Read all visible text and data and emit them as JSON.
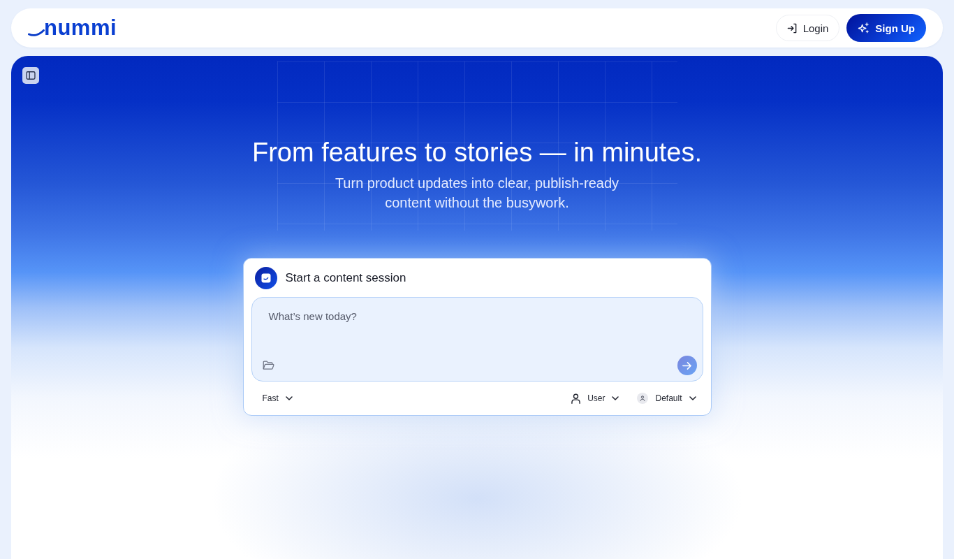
{
  "header": {
    "logo": "nummi",
    "buttons": [
      {
        "kind": "login",
        "label": "Login"
      },
      {
        "kind": "signup",
        "label": "Sign Up"
      }
    ]
  },
  "hero": {
    "title": "From features to stories — in minutes.",
    "subtitle": "Turn product updates into clear, publish-ready content without the busywork."
  },
  "session_card": {
    "title": "Start a content session",
    "prompt": {
      "placeholder": "What’s new today?"
    },
    "options": [
      {
        "kind": "speed",
        "label": "Fast"
      },
      {
        "kind": "role",
        "label": "User"
      },
      {
        "kind": "persona",
        "label": "Default"
      }
    ]
  }
}
